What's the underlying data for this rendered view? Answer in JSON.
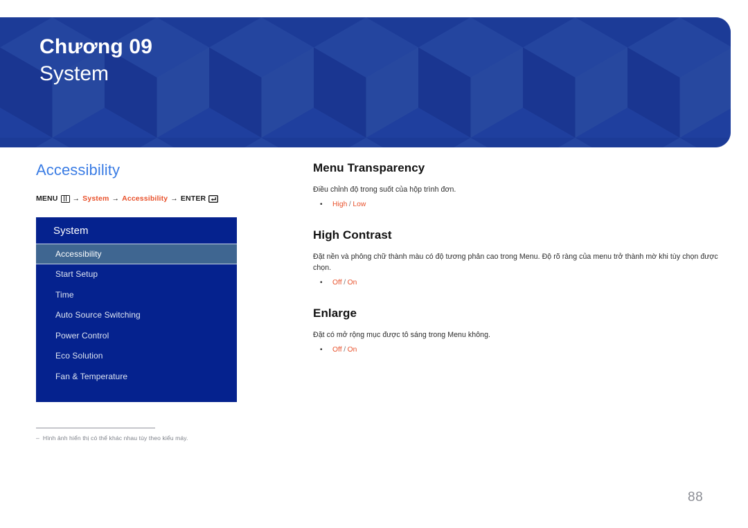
{
  "banner": {
    "chapter_label": "Chương 09",
    "chapter_title": "System",
    "background_color": "#1f3f9e"
  },
  "left_column": {
    "section_title": "Accessibility",
    "section_title_color": "#3a7ce4",
    "breadcrumb": {
      "menu_label": "MENU",
      "menu_icon": "menu-grid-icon",
      "arrow_1": "→",
      "link_1": "System",
      "arrow_2": "→",
      "link_2": "Accessibility",
      "arrow_3": "→",
      "enter_label": "ENTER",
      "enter_icon": "enter-return-icon",
      "link_color": "#e8502a"
    },
    "osd_menu": {
      "header": "System",
      "header_bg": "#05228e",
      "selected_bg": "#3f6691",
      "items": [
        {
          "label": "Accessibility",
          "selected": true
        },
        {
          "label": "Start Setup",
          "selected": false
        },
        {
          "label": "Time",
          "selected": false
        },
        {
          "label": "Auto Source Switching",
          "selected": false
        },
        {
          "label": "Power Control",
          "selected": false
        },
        {
          "label": "Eco Solution",
          "selected": false
        },
        {
          "label": "Fan & Temperature",
          "selected": false
        }
      ]
    },
    "footnote": {
      "dash": "‒",
      "text": "Hình ảnh hiển thị có thể khác nhau tùy theo kiểu máy."
    }
  },
  "right_column": {
    "blocks": [
      {
        "title": "Menu Transparency",
        "description": "Điều chỉnh độ trong suốt của hộp trình đơn.",
        "options": [
          {
            "bullet": "•",
            "value_1": "High",
            "separator": "/",
            "value_2": "Low"
          }
        ]
      },
      {
        "title": "High Contrast",
        "description": "Đặt nền và phông chữ thành màu có độ tương phản cao trong Menu. Độ rõ ràng của menu trở thành mờ khi tùy chọn được chọn.",
        "options": [
          {
            "bullet": "•",
            "value_1": "Off",
            "separator": "/",
            "value_2": "On"
          }
        ]
      },
      {
        "title": "Enlarge",
        "description": "Đặt có mở rộng mục được tô sáng trong Menu không.",
        "options": [
          {
            "bullet": "•",
            "value_1": "Off",
            "separator": "/",
            "value_2": "On"
          }
        ]
      }
    ]
  },
  "footer": {
    "page_number": "88"
  }
}
